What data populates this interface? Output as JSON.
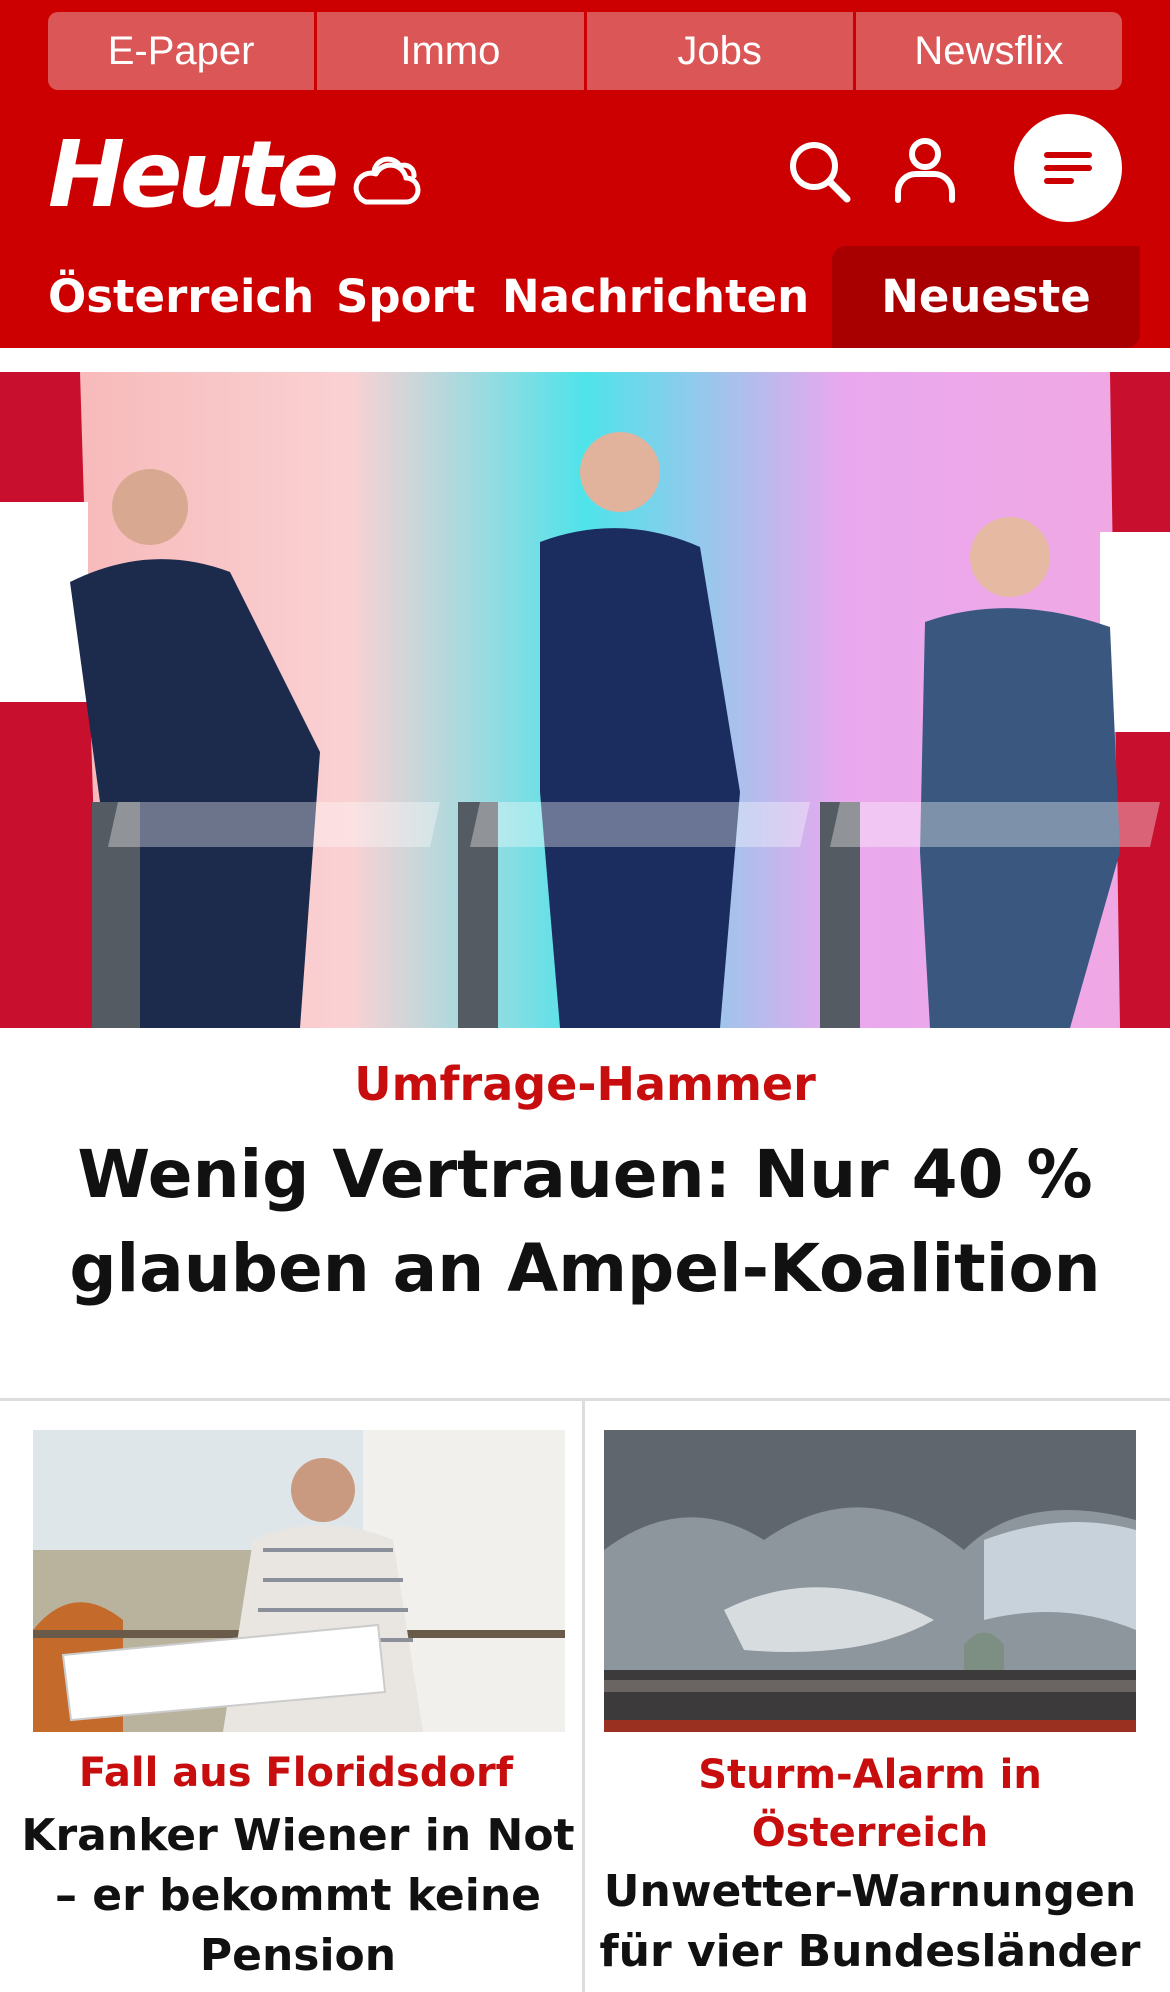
{
  "service_bar": {
    "items": [
      {
        "label": "E-Paper"
      },
      {
        "label": "Immo"
      },
      {
        "label": "Jobs"
      },
      {
        "label": "Newsflix"
      }
    ]
  },
  "brand": {
    "logo_text": "Heute",
    "icons": [
      "weather-cloud-icon",
      "search-icon",
      "user-icon",
      "menu-icon"
    ]
  },
  "nav": {
    "items": [
      {
        "label": "Österreich"
      },
      {
        "label": "Sport"
      },
      {
        "label": "Nachrichten"
      },
      {
        "label": "Neueste"
      }
    ],
    "active": "Neueste"
  },
  "hero": {
    "kicker": "Umfrage-Hammer",
    "title": "Wenig Vertrauen: Nur 40 % glauben an Ampel-Koalition"
  },
  "teasers": [
    {
      "kicker": "Fall aus Floridsdorf",
      "title": "Kranker Wiener in Not – er bekommt keine Pension"
    },
    {
      "kicker": "Sturm-Alarm in Österreich",
      "title": "Unwetter-Warnungen für vier Bundesländer"
    }
  ],
  "colors": {
    "brand_red": "#cc0000",
    "active_nav": "#a80000",
    "service_bar": "#db5656",
    "kicker_red": "#c70d0d",
    "text": "#111111"
  }
}
